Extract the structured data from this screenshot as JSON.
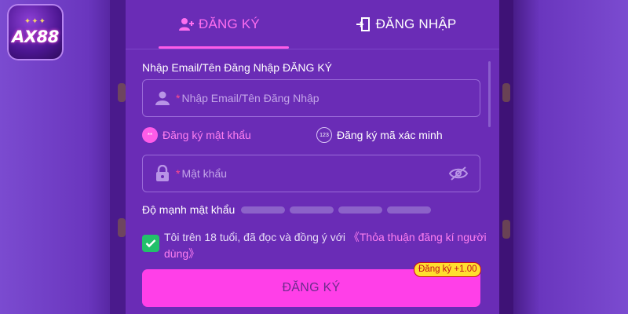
{
  "brand": {
    "logo_text": "AX88"
  },
  "tabs": {
    "register": "ĐĂNG KÝ",
    "login": "ĐĂNG NHẬP"
  },
  "form": {
    "username_label": "Nhập Email/Tên Đăng Nhập ĐĂNG KÝ",
    "username_placeholder": "Nhập Email/Tên Đăng Nhập",
    "required_mark": "*",
    "mode_password": "Đăng ký mật khẩu",
    "mode_password_badge": "**",
    "mode_code": "Đăng ký mã xác minh",
    "mode_code_badge": "123",
    "password_placeholder": "Mật khẩu",
    "strength_label": "Độ mạnh mật khẩu",
    "strength_level": 0,
    "strength_segments": 4,
    "agree_text": "Tôi trên 18 tuổi, đã đọc và đồng ý với ",
    "agree_link": "《Thỏa thuận đăng kí người dùng》",
    "agree_checked": true,
    "submit_label": "ĐĂNG KÝ",
    "bonus_badge": "Đăng ký +1.00"
  },
  "colors": {
    "background": "#6f3fc0",
    "panel": "#6a2cb6",
    "accent": "#ff3fe8",
    "active_tab": "#ff6ef0",
    "checkbox": "#22c06a",
    "badge": "#ffde2e"
  }
}
